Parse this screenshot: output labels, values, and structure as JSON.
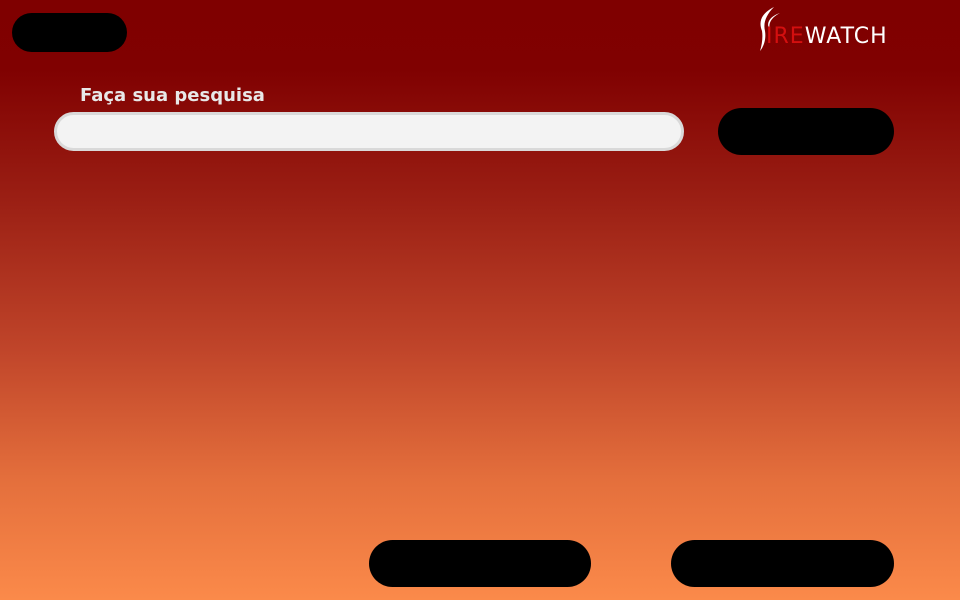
{
  "logo": {
    "text_prefix": "IRE",
    "text_suffix": "WATCH",
    "brand_color": "#d40f0f"
  },
  "search": {
    "label": "Faça sua pesquisa",
    "value": "",
    "placeholder": ""
  },
  "buttons": {
    "top_left_label": "",
    "search_label": "",
    "bottom_left_label": "",
    "bottom_right_label": ""
  },
  "colors": {
    "gradient_top": "#7f0000",
    "gradient_bottom": "#fb8a4a",
    "button_fill": "#000000"
  }
}
